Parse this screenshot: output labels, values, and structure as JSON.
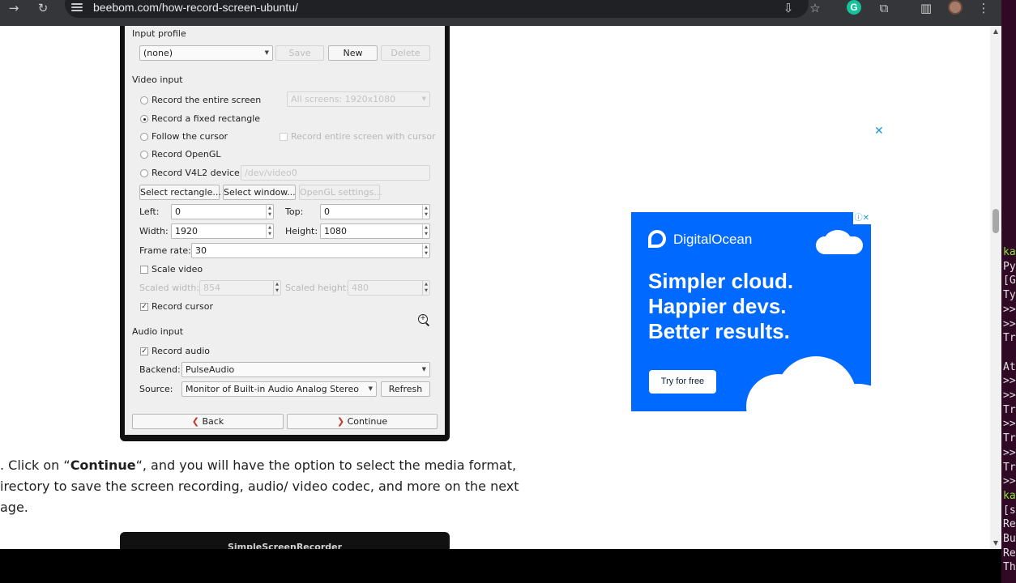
{
  "browser": {
    "url": "beebom.com/how-record-screen-ubuntu/",
    "extension_letter": "G"
  },
  "ssr": {
    "input_profile": {
      "title": "Input profile",
      "selected": "(none)",
      "save": "Save",
      "new": "New",
      "delete": "Delete"
    },
    "video_input": {
      "title": "Video input",
      "options": {
        "entire_screen": "Record the entire screen",
        "fixed_rect": "Record a fixed rectangle",
        "follow_cursor": "Follow the cursor",
        "opengl": "Record OpenGL",
        "v4l2": "Record V4L2 device"
      },
      "selected_option": "fixed_rect",
      "screens_combo": "All screens: 1920x1080",
      "record_entire_with_cursor": "Record entire screen with cursor",
      "v4l2_device": "/dev/video0",
      "select_rectangle": "Select rectangle...",
      "select_window": "Select window...",
      "opengl_settings": "OpenGL settings...",
      "left_label": "Left:",
      "left": "0",
      "top_label": "Top:",
      "top": "0",
      "width_label": "Width:",
      "width": "1920",
      "height_label": "Height:",
      "height": "1080",
      "frame_rate_label": "Frame rate:",
      "frame_rate": "30",
      "scale_video": "Scale video",
      "scaled_width_label": "Scaled width:",
      "scaled_width": "854",
      "scaled_height_label": "Scaled height:",
      "scaled_height": "480",
      "record_cursor": "Record cursor"
    },
    "audio_input": {
      "title": "Audio input",
      "record_audio": "Record audio",
      "backend_label": "Backend:",
      "backend": "PulseAudio",
      "source_label": "Source:",
      "source": "Monitor of Built-in Audio Analog Stereo",
      "refresh": "Refresh"
    },
    "back": "Back",
    "continue": "Continue",
    "next_window_title": "SimpleScreenRecorder"
  },
  "article": {
    "line1_pre": ". Click on “",
    "line1_bold": "Continue",
    "line1_post": "“, and you will have the option to select the media format,",
    "line2": "irectory to save the screen recording, audio/ video codec, and more on the next",
    "line3": "age."
  },
  "ad": {
    "brand": "DigitalOcean",
    "headline1": "Simpler cloud.",
    "headline2": "Happier devs.",
    "headline3": "Better results.",
    "cta": "Try for free",
    "close_glyph": "✕",
    "badge_info": "ⓘ",
    "badge_close": "✕",
    "brand_color": "#0069ff"
  },
  "terminal": {
    "lines": [
      "ka",
      "Py",
      "[G",
      "Ty",
      ">>",
      ">>",
      "Tr",
      "",
      "At",
      ">>",
      ">>",
      "Tr",
      ">>",
      "Tr",
      ">>",
      "Tr",
      ">>",
      "ka",
      "[s",
      "Re",
      "Bu",
      "Re",
      "Th"
    ]
  }
}
